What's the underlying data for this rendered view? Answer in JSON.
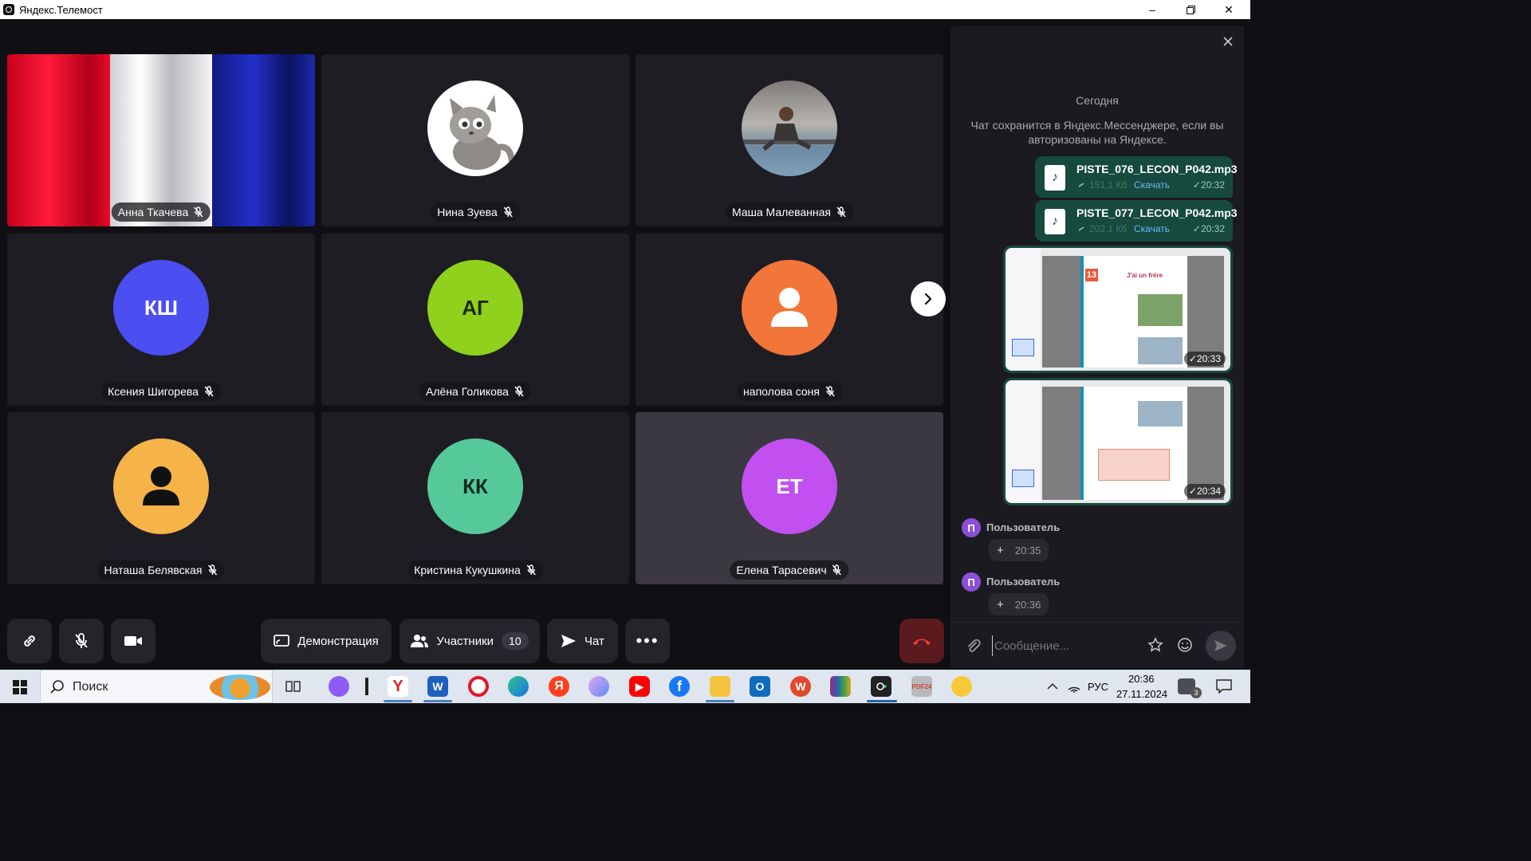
{
  "window": {
    "title": "Яндекс.Телемост"
  },
  "participants": [
    {
      "name": "Анна Ткачева",
      "initials": "",
      "avatar": "flag",
      "color": ""
    },
    {
      "name": "Нина Зуева",
      "initials": "",
      "avatar": "photo-cat",
      "color": ""
    },
    {
      "name": "Маша Малеванная",
      "initials": "",
      "avatar": "photo-person",
      "color": ""
    },
    {
      "name": "Ксения Шигорева",
      "initials": "КШ",
      "avatar": "initials",
      "color": "#4b4ef0"
    },
    {
      "name": "Алёна Голикова",
      "initials": "АГ",
      "avatar": "initials",
      "color": "#8fd11c"
    },
    {
      "name": "наполова соня",
      "initials": "",
      "avatar": "person-icon",
      "color": "#f2753a"
    },
    {
      "name": "Наташа Белявская",
      "initials": "",
      "avatar": "person-icon",
      "color": "#f5b348"
    },
    {
      "name": "Кристина Кукушкина",
      "initials": "КК",
      "avatar": "initials",
      "color": "#55c99a"
    },
    {
      "name": "Елена Тарасевич",
      "initials": "ЕТ",
      "avatar": "initials",
      "color": "#c250f0"
    }
  ],
  "toolbar": {
    "screen_share_label": "Демонстрация",
    "participants_label": "Участники",
    "participants_count": "10",
    "chat_label": "Чат"
  },
  "chat": {
    "date_label": "Сегодня",
    "notice": "Чат сохранится в Яндекс.Мессенджере, если вы авторизованы на Яндексе.",
    "files": [
      {
        "name": "PISTE_076_LECON_P042.mp3",
        "size": "151,1 Кб",
        "download": "Скачать",
        "time": "20:32"
      },
      {
        "name": "PISTE_077_LECON_P042.mp3",
        "size": "202,1 Кб",
        "download": "Скачать",
        "time": "20:32"
      }
    ],
    "images": [
      {
        "time": "20:33",
        "page_number": "13",
        "heading": "J'ai un frère"
      },
      {
        "time": "20:34"
      }
    ],
    "user_messages": [
      {
        "initial": "П",
        "name": "Пользователь",
        "reaction": "+",
        "time": "20:35"
      },
      {
        "initial": "П",
        "name": "Пользователь",
        "reaction": "+",
        "time": "20:36"
      }
    ],
    "input_placeholder": "Сообщение..."
  },
  "taskbar": {
    "search_label": "Поиск",
    "language": "РУС",
    "time": "20:36",
    "date": "27.11.2024",
    "notification_count": "3"
  },
  "colors": {
    "background": "#0f0f14",
    "tile": "#1e1d24",
    "chat_file_bubble": "#164a3e",
    "hangup": "#5a1a1e"
  }
}
